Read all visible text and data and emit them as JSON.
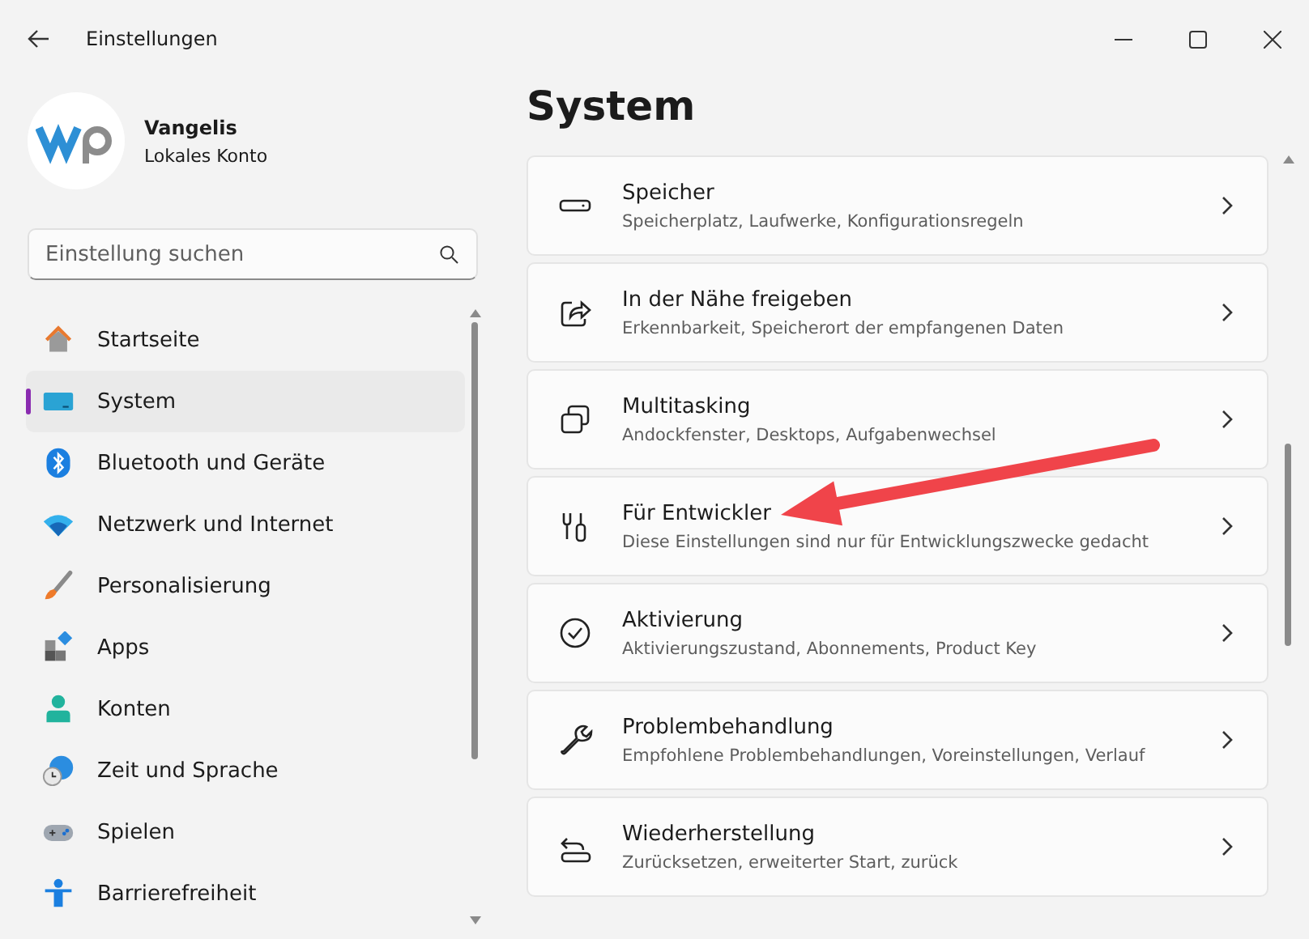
{
  "window": {
    "title": "Einstellungen"
  },
  "profile": {
    "name": "Vangelis",
    "account": "Lokales Konto"
  },
  "search": {
    "placeholder": "Einstellung suchen"
  },
  "sidebar": {
    "items": [
      {
        "label": "Startseite",
        "selected": false
      },
      {
        "label": "System",
        "selected": true
      },
      {
        "label": "Bluetooth und Geräte",
        "selected": false
      },
      {
        "label": "Netzwerk und Internet",
        "selected": false
      },
      {
        "label": "Personalisierung",
        "selected": false
      },
      {
        "label": "Apps",
        "selected": false
      },
      {
        "label": "Konten",
        "selected": false
      },
      {
        "label": "Zeit und Sprache",
        "selected": false
      },
      {
        "label": "Spielen",
        "selected": false
      },
      {
        "label": "Barrierefreiheit",
        "selected": false
      }
    ]
  },
  "page": {
    "title": "System",
    "cards": [
      {
        "title": "Speicher",
        "subtitle": "Speicherplatz, Laufwerke, Konfigurationsregeln"
      },
      {
        "title": "In der Nähe freigeben",
        "subtitle": "Erkennbarkeit, Speicherort der empfangenen Daten"
      },
      {
        "title": "Multitasking",
        "subtitle": "Andockfenster, Desktops, Aufgabenwechsel"
      },
      {
        "title": "Für Entwickler",
        "subtitle": "Diese Einstellungen sind nur für Entwicklungszwecke gedacht"
      },
      {
        "title": "Aktivierung",
        "subtitle": "Aktivierungszustand, Abonnements, Product Key"
      },
      {
        "title": "Problembehandlung",
        "subtitle": "Empfohlene Problembehandlungen, Voreinstellungen, Verlauf"
      },
      {
        "title": "Wiederherstellung",
        "subtitle": "Zurücksetzen, erweiterter Start, zurück"
      }
    ]
  }
}
